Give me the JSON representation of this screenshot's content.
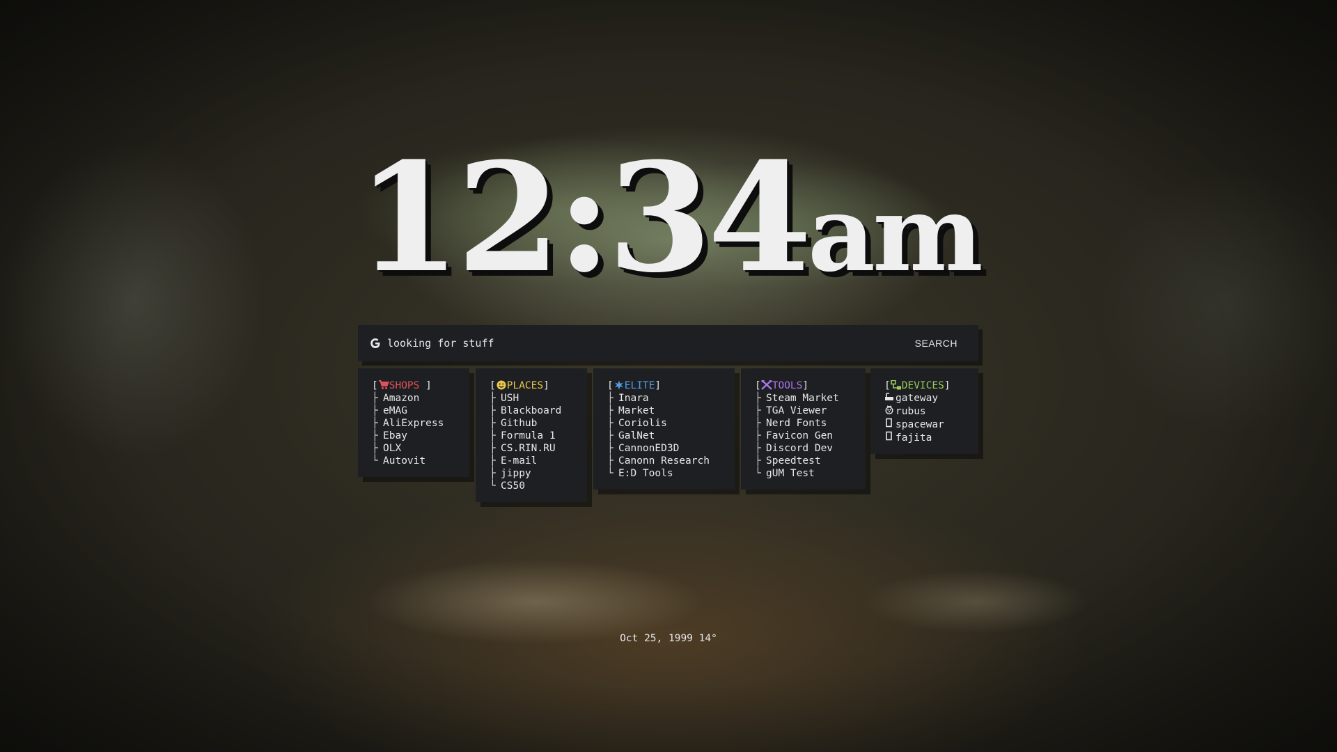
{
  "clock": {
    "time": "12:34",
    "ampm": "am"
  },
  "search": {
    "engine_icon": "google-g-icon",
    "placeholder": "looking for stuff",
    "button_label": "SEARCH"
  },
  "cards": {
    "shops": {
      "title": "SHOPS",
      "title_color": "#e0525a",
      "icon": "cart-icon",
      "items": [
        "Amazon",
        "eMAG",
        "AliExpress",
        "Ebay",
        "OLX",
        "Autovit"
      ]
    },
    "places": {
      "title": "PLACES",
      "title_color": "#e8c84a",
      "icon": "smiley-icon",
      "items": [
        "USH",
        "Blackboard",
        "Github",
        "Formula 1",
        "CS.RIN.RU",
        "E-mail",
        "jippy",
        "CS50"
      ]
    },
    "elite": {
      "title": "ELITE",
      "title_color": "#4f9ee8",
      "icon": "star-icon",
      "items": [
        "Inara",
        "Market",
        "Coriolis",
        "GalNet",
        "CannonED3D",
        "Canonn Research",
        "E:D Tools"
      ]
    },
    "tools": {
      "title": "TOOLS",
      "title_color": "#a878e8",
      "icon": "tools-icon",
      "items": [
        "Steam Market",
        "TGA Viewer",
        "Nerd Fonts",
        "Favicon Gen",
        "Discord Dev",
        "Speedtest",
        "gUM Test"
      ]
    },
    "devices": {
      "title": "DEVICES",
      "title_color": "#9acb5a",
      "icon": "network-icon",
      "items": [
        {
          "label": "gateway",
          "icon": "router-icon"
        },
        {
          "label": "rubus",
          "icon": "raspberry-icon"
        },
        {
          "label": "spacewar",
          "icon": "server-icon"
        },
        {
          "label": "fajita",
          "icon": "server-icon"
        }
      ]
    }
  },
  "footer": {
    "date_weather": "Oct 25, 1999 14°"
  }
}
